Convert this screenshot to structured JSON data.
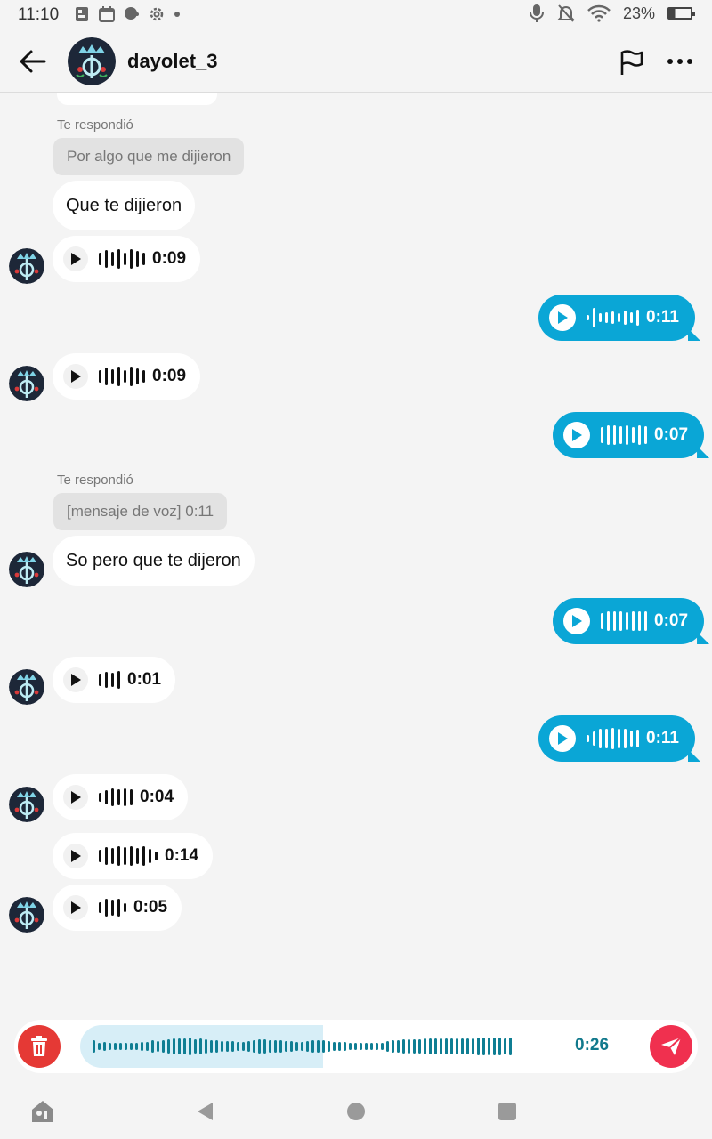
{
  "status_bar": {
    "time": "11:10",
    "battery": "23%"
  },
  "header": {
    "username": "dayolet_3"
  },
  "colors": {
    "accent": "#0aa6d6",
    "delete": "#e53935",
    "send": "#f0304f",
    "waveform": "#0f7e93"
  },
  "messages": [
    {
      "reply_label": "Te respondió",
      "quote": "Por algo que me dijieron"
    },
    {
      "text": "Que te dijieron"
    },
    {
      "voice_duration": "0:09"
    },
    {
      "voice_duration": "0:11"
    },
    {
      "voice_duration": "0:09"
    },
    {
      "voice_duration": "0:07"
    },
    {
      "reply_label": "Te respondió",
      "quote": "[mensaje de voz] 0:11"
    },
    {
      "text": "So pero que te dijeron"
    },
    {
      "voice_duration": "0:07"
    },
    {
      "voice_duration": "0:01"
    },
    {
      "voice_duration": "0:11"
    },
    {
      "voice_duration": "0:04"
    },
    {
      "voice_duration": "0:14"
    },
    {
      "voice_duration": "0:05"
    }
  ],
  "recording": {
    "duration": "0:26",
    "progress": 0.44
  },
  "icons": [
    "back-arrow-icon",
    "flag-icon",
    "more-icon",
    "play-icon",
    "trash-icon",
    "send-icon",
    "mic-icon",
    "notifications-off-icon",
    "wifi-icon",
    "battery-icon"
  ]
}
